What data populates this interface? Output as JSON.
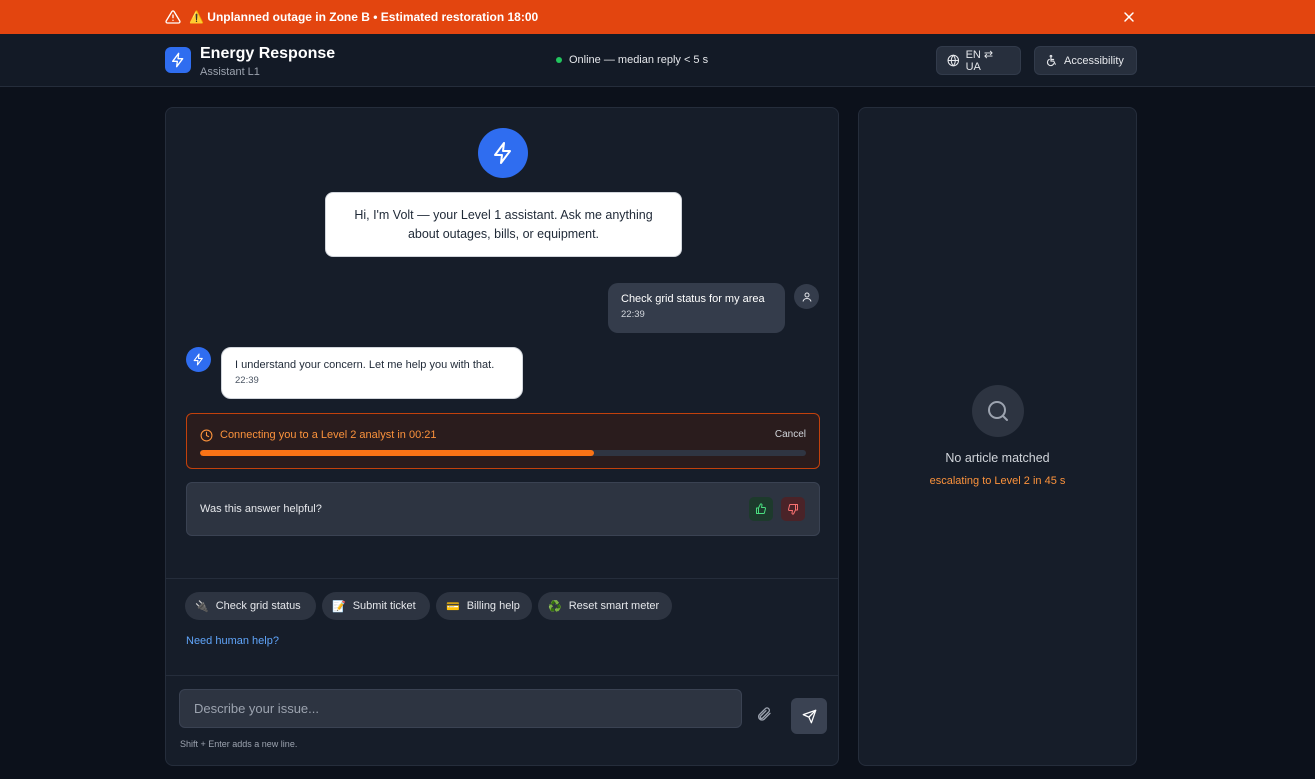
{
  "banner": {
    "text": "⚠️ Unplanned outage in Zone B • Estimated restoration 18:00",
    "color": "#e3450f"
  },
  "header": {
    "title": "Energy Response",
    "subtitle": "Assistant L1",
    "status": "Online — median reply < 5 s",
    "language_label": "EN ⇄ UA",
    "accessibility_label": "Accessibility"
  },
  "chat": {
    "greeting": "Hi, I'm Volt — your Level 1 assistant. Ask me anything about outages, bills, or equipment.",
    "messages": [
      {
        "role": "user",
        "text": "Check grid status for my area",
        "time": "22:39"
      },
      {
        "role": "bot",
        "text": "I understand your concern. Let me help you with that.",
        "time": "22:39"
      }
    ],
    "escalation": {
      "text": "Connecting you to a Level 2 analyst in 00:21",
      "cancel_label": "Cancel",
      "progress_percent": 65
    },
    "feedback": {
      "question": "Was this answer helpful?"
    },
    "quick_replies": [
      {
        "emoji": "🔌",
        "label": "Check grid status"
      },
      {
        "emoji": "📝",
        "label": "Submit ticket"
      },
      {
        "emoji": "💳",
        "label": "Billing help"
      },
      {
        "emoji": "♻️",
        "label": "Reset smart meter"
      }
    ],
    "human_help_link": "Need human help?",
    "input": {
      "placeholder": "Describe your issue...",
      "value": ""
    },
    "hint": "Shift + Enter adds a new line."
  },
  "side_panel": {
    "empty_title": "No article matched",
    "escalation_note": "escalating to Level 2 in 45 s"
  },
  "colors": {
    "accent": "#2f6df0",
    "warning": "#f97316",
    "online": "#22c55e",
    "link": "#60a5fa"
  }
}
